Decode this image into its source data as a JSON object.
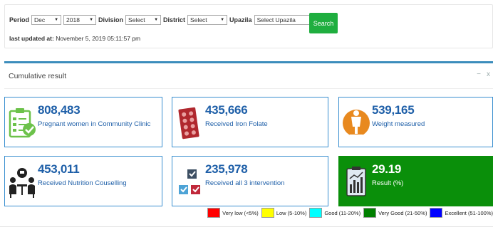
{
  "filters": {
    "period_label": "Period",
    "month": "Dec",
    "year": "2018",
    "division_label": "Division",
    "division": "Select",
    "district_label": "District",
    "district": "Select",
    "upazila_label": "Upazila",
    "upazila": "Select Upazila",
    "search_label": "Search"
  },
  "last_updated": {
    "label": "last updated at:",
    "value": "November 5, 2019 05:11:57 pm"
  },
  "panel": {
    "title": "Cumulative result",
    "minimize": "−",
    "close": "x"
  },
  "cards": [
    {
      "value": "808,483",
      "label": "Pregnant women in Community Clinic",
      "icon": "clipboard-checklist-icon",
      "color": "#6cc24a"
    },
    {
      "value": "435,666",
      "label": "Received Iron Folate",
      "icon": "tablet-pack-icon",
      "color": "#b0282e"
    },
    {
      "value": "539,165",
      "label": "Weight measured",
      "icon": "scale-person-icon",
      "color": "#e8891f"
    },
    {
      "value": "453,011",
      "label": "Received Nutrition Couselling",
      "icon": "counselling-people-icon",
      "color": "#222222"
    },
    {
      "value": "235,978",
      "label": "Received all 3 intervention",
      "icon": "checkboxes-icon",
      "color": "#3a7ca5"
    },
    {
      "value": "29.19",
      "label": "Result (%)",
      "icon": "bar-chart-icon",
      "color": "#0a8f0a"
    }
  ],
  "legend": [
    {
      "label": "Very low (<5%)",
      "color": "#ff0000"
    },
    {
      "label": "Low (5-10%)",
      "color": "#ffff00"
    },
    {
      "label": "Good (11-20%)",
      "color": "#00ffff"
    },
    {
      "label": "Very Good (21-50%)",
      "color": "#008000"
    },
    {
      "label": "Excellent (51-100%)",
      "color": "#0000ff"
    }
  ]
}
